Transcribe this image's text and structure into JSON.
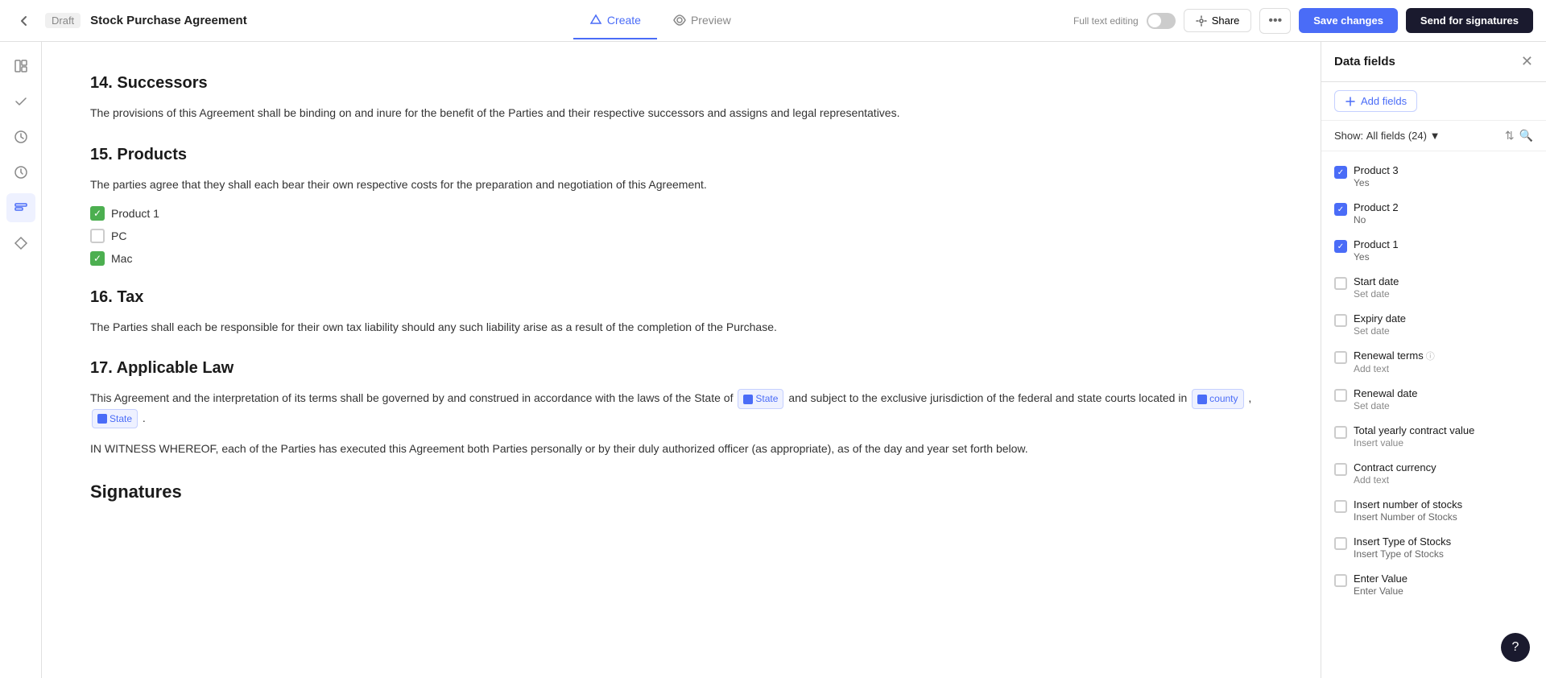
{
  "header": {
    "back_label": "←",
    "draft_label": "Draft",
    "title": "Stock Purchase Agreement",
    "tabs": [
      {
        "id": "create",
        "label": "Create",
        "active": true
      },
      {
        "id": "preview",
        "label": "Preview",
        "active": false
      }
    ],
    "full_text_editing": "Full text editing",
    "share_label": "Share",
    "more_label": "•••",
    "save_label": "Save changes",
    "send_label": "Send for signatures"
  },
  "sections": [
    {
      "id": "successors",
      "number": "14.",
      "title": "Successors",
      "paragraphs": [
        "The provisions of this Agreement shall be binding on and inure for the benefit of the Parties and their respective successors and assigns and legal representatives."
      ]
    },
    {
      "id": "products",
      "number": "15.",
      "title": "Products",
      "paragraphs": [
        "The parties agree that they shall each bear their own respective costs for the preparation and negotiation of this Agreement."
      ],
      "checkboxes": [
        {
          "id": "product1",
          "label": "Product 1",
          "checked": true
        },
        {
          "id": "pc",
          "label": "PC",
          "checked": false
        },
        {
          "id": "mac",
          "label": "Mac",
          "checked": true
        }
      ]
    },
    {
      "id": "tax",
      "number": "16.",
      "title": "Tax",
      "paragraphs": [
        "The Parties shall each be responsible for their own tax liability should any such liability arise as a result of the completion of the Purchase."
      ]
    },
    {
      "id": "applicable-law",
      "number": "17.",
      "title": "Applicable Law",
      "paragraphs": [
        "This Agreement and the interpretation of its terms shall be governed by and construed in accordance with the laws of the State of {State} and subject to the exclusive jurisdiction of the federal and state courts located in {county} , {State} .",
        "IN WITNESS WHEREOF, each of the Parties has executed this Agreement both Parties personally or by their duly authorized officer (as appropriate), as of the day and year set forth below."
      ]
    }
  ],
  "signatures": {
    "title": "Signatures"
  },
  "right_panel": {
    "title": "Data fields",
    "add_fields_label": "Add fields",
    "show_label": "Show:",
    "all_fields_label": "All fields",
    "count": "(24)",
    "fields": [
      {
        "id": "product3",
        "name": "Product 3",
        "value": "Yes",
        "checked": true
      },
      {
        "id": "product2",
        "name": "Product 2",
        "value": "No",
        "checked": true
      },
      {
        "id": "product1",
        "name": "Product 1",
        "value": "Yes",
        "checked": true
      },
      {
        "id": "start-date",
        "name": "Start date",
        "value": "Set date",
        "checked": false,
        "placeholder": true
      },
      {
        "id": "expiry-date",
        "name": "Expiry date",
        "value": "Set date",
        "checked": false,
        "placeholder": true
      },
      {
        "id": "renewal-terms",
        "name": "Renewal terms",
        "value": "Add text",
        "checked": false,
        "placeholder": true,
        "has_info": true
      },
      {
        "id": "renewal-date",
        "name": "Renewal date",
        "value": "Set date",
        "checked": false,
        "placeholder": true
      },
      {
        "id": "total-yearly",
        "name": "Total yearly contract value",
        "value": "Insert value",
        "checked": false,
        "placeholder": true
      },
      {
        "id": "contract-currency",
        "name": "Contract currency",
        "value": "Add text",
        "checked": false,
        "placeholder": true
      },
      {
        "id": "insert-number-stocks",
        "name": "Insert number of stocks",
        "value": "Insert Number of Stocks",
        "checked": false
      },
      {
        "id": "insert-type-stocks",
        "name": "Insert Type of Stocks",
        "value": "Insert Type of Stocks",
        "checked": false
      },
      {
        "id": "enter-value",
        "name": "Enter Value",
        "value": "Enter Value",
        "checked": false
      }
    ]
  },
  "help": {
    "label": "?"
  }
}
